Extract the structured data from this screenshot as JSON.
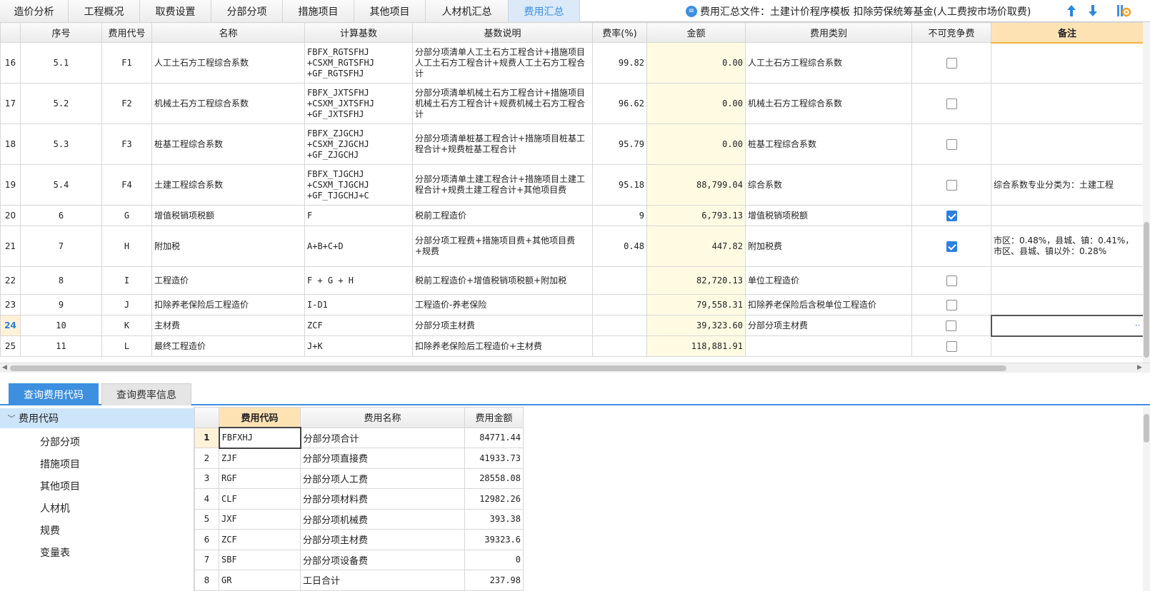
{
  "tabs": [
    {
      "label": "造价分析",
      "active": false
    },
    {
      "label": "工程概况",
      "active": false
    },
    {
      "label": "取费设置",
      "active": false
    },
    {
      "label": "分部分项",
      "active": false
    },
    {
      "label": "措施项目",
      "active": false
    },
    {
      "label": "其他项目",
      "active": false
    },
    {
      "label": "人材机汇总",
      "active": false
    },
    {
      "label": "费用汇总",
      "active": true
    }
  ],
  "file_info": "费用汇总文件：土建计价程序模板 扣除劳保统筹基金(人工费按市场价取费)",
  "icons": {
    "doc": "document-icon",
    "up": "arrow-up-icon",
    "down": "arrow-down-icon",
    "settings": "settings-icon"
  },
  "accent_color": "#3d8fe0",
  "columns": [
    "序号",
    "费用代号",
    "名称",
    "计算基数",
    "基数说明",
    "费率(%)",
    "金额",
    "费用类别",
    "不可竞争费",
    "备注"
  ],
  "rows": [
    {
      "row": "16",
      "seq": "5.1",
      "code": "F1",
      "name": "人工土石方工程综合系数",
      "base": [
        "FBFX_RGTSFHJ",
        "+CSXM_RGTSFHJ",
        "+GF_RGTSFHJ"
      ],
      "desc": "分部分项清单人工土石方工程合计+措施项目人工土石方工程合计+规费人工土石方工程合计",
      "rate": "99.82",
      "amount": "0.00",
      "category": "人工土石方工程综合系数",
      "noncompete": false,
      "remark": ""
    },
    {
      "row": "17",
      "seq": "5.2",
      "code": "F2",
      "name": "机械土石方工程综合系数",
      "base": [
        "FBFX_JXTSFHJ",
        "+CSXM_JXTSFHJ",
        "+GF_JXTSFHJ"
      ],
      "desc": "分部分项清单机械土石方工程合计+措施项目机械土石方工程合计+规费机械土石方工程合计",
      "rate": "96.62",
      "amount": "0.00",
      "category": "机械土石方工程综合系数",
      "noncompete": false,
      "remark": ""
    },
    {
      "row": "18",
      "seq": "5.3",
      "code": "F3",
      "name": "桩基工程综合系数",
      "base": [
        "FBFX_ZJGCHJ",
        "+CSXM_ZJGCHJ",
        "+GF_ZJGCHJ"
      ],
      "desc": "分部分项清单桩基工程合计+措施项目桩基工程合计+规费桩基工程合计",
      "rate": "95.79",
      "amount": "0.00",
      "category": "桩基工程综合系数",
      "noncompete": false,
      "remark": ""
    },
    {
      "row": "19",
      "seq": "5.4",
      "code": "F4",
      "name": "土建工程综合系数",
      "base": [
        "FBFX_TJGCHJ",
        "+CSXM_TJGCHJ",
        "+GF_TJGCHJ+C"
      ],
      "desc": "分部分项清单土建工程合计+措施项目土建工程合计+规费土建工程合计+其他项目费",
      "rate": "95.18",
      "amount": "88,799.04",
      "category": "综合系数",
      "noncompete": false,
      "remark": "综合系数专业分类为：土建工程"
    },
    {
      "row": "20",
      "seq": "6",
      "code": "G",
      "name": "增值税销项税额",
      "base": [
        "F"
      ],
      "desc": "税前工程造价",
      "rate": "9",
      "amount": "6,793.13",
      "category": "增值税销项税额",
      "noncompete": true,
      "remark": ""
    },
    {
      "row": "21",
      "seq": "7",
      "code": "H",
      "name": "附加税",
      "base": [
        "A+B+C+D"
      ],
      "desc": "分部分项工程费+措施项目费+其他项目费+规费",
      "rate": "0.48",
      "amount": "447.82",
      "category": "附加税费",
      "noncompete": true,
      "remark": "市区：0.48%，县城、镇：0.41%，市区、县城、镇以外：0.28%"
    },
    {
      "row": "22",
      "seq": "8",
      "code": "I",
      "name": "工程造价",
      "base": [
        "F + G + H"
      ],
      "desc": "税前工程造价+增值税销项税额+附加税",
      "rate": "",
      "amount": "82,720.13",
      "category": "单位工程造价",
      "noncompete": false,
      "remark": ""
    },
    {
      "row": "23",
      "seq": "9",
      "code": "J",
      "name": "扣除养老保险后工程造价",
      "base": [
        "I-D1"
      ],
      "desc": "工程造价-养老保险",
      "rate": "",
      "amount": "79,558.31",
      "category": "扣除养老保险后含税单位工程造价",
      "noncompete": false,
      "remark": ""
    },
    {
      "row": "24",
      "seq": "10",
      "code": "K",
      "name": "主材费",
      "base": [
        "ZCF"
      ],
      "desc": "分部分项主材费",
      "rate": "",
      "amount": "39,323.60",
      "category": "分部分项主材费",
      "noncompete": false,
      "remark": "",
      "current": true
    },
    {
      "row": "25",
      "seq": "11",
      "code": "L",
      "name": "最终工程造价",
      "base": [
        "J+K"
      ],
      "desc": "扣除养老保险后工程造价+主材费",
      "rate": "",
      "amount": "118,881.91",
      "category": "",
      "noncompete": false,
      "remark": ""
    }
  ],
  "bottom_tabs": [
    {
      "label": "查询费用代码",
      "active": true
    },
    {
      "label": "查询费率信息",
      "active": false
    }
  ],
  "tree": {
    "root": "费用代码",
    "children": [
      "分部分项",
      "措施项目",
      "其他项目",
      "人材机",
      "规费",
      "变量表"
    ]
  },
  "codes_columns": [
    "费用代码",
    "费用名称",
    "费用金额"
  ],
  "codes": [
    {
      "idx": "1",
      "code": "FBFXHJ",
      "name": "分部分项合计",
      "amount": "84771.44"
    },
    {
      "idx": "2",
      "code": "ZJF",
      "name": "分部分项直接费",
      "amount": "41933.73"
    },
    {
      "idx": "3",
      "code": "RGF",
      "name": "分部分项人工费",
      "amount": "28558.08"
    },
    {
      "idx": "4",
      "code": "CLF",
      "name": "分部分项材料费",
      "amount": "12982.26"
    },
    {
      "idx": "5",
      "code": "JXF",
      "name": "分部分项机械费",
      "amount": "393.38"
    },
    {
      "idx": "6",
      "code": "ZCF",
      "name": "分部分项主材费",
      "amount": "39323.6"
    },
    {
      "idx": "7",
      "code": "SBF",
      "name": "分部分项设备费",
      "amount": "0"
    },
    {
      "idx": "8",
      "code": "GR",
      "name": "工日合计",
      "amount": "237.98"
    }
  ]
}
